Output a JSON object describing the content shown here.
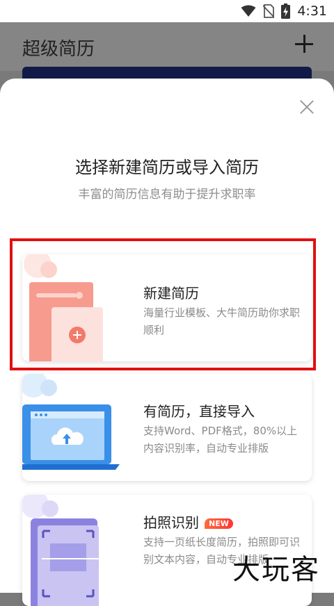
{
  "status": {
    "time": "4:31",
    "icons": [
      "wifi-icon",
      "no-sim-icon",
      "battery-charging-icon"
    ]
  },
  "app": {
    "title": "超级简历"
  },
  "dialog": {
    "title": "选择新建简历或导入简历",
    "subtitle": "丰富的简历信息有助于提升求职率",
    "options": [
      {
        "title": "新建简历",
        "desc": "海量行业模板、大牛简历助你求职顺利",
        "icon": "new-resume-illustration"
      },
      {
        "title": "有简历，直接导入",
        "desc": "支持Word、PDF格式，80%以上内容识别率，自动专业排版",
        "icon": "laptop-upload-illustration"
      },
      {
        "title": "拍照识别",
        "badge": "NEW",
        "desc": "支持一页纸长度简历，拍照即可识别文本内容，自动专业排版",
        "icon": "photo-scan-illustration"
      }
    ]
  },
  "watermark": "大玩客",
  "colors": {
    "highlight": "#e01010",
    "accent_red": "#f25a4a",
    "accent_blue": "#3a8fe8",
    "accent_purple": "#8b82e0"
  }
}
